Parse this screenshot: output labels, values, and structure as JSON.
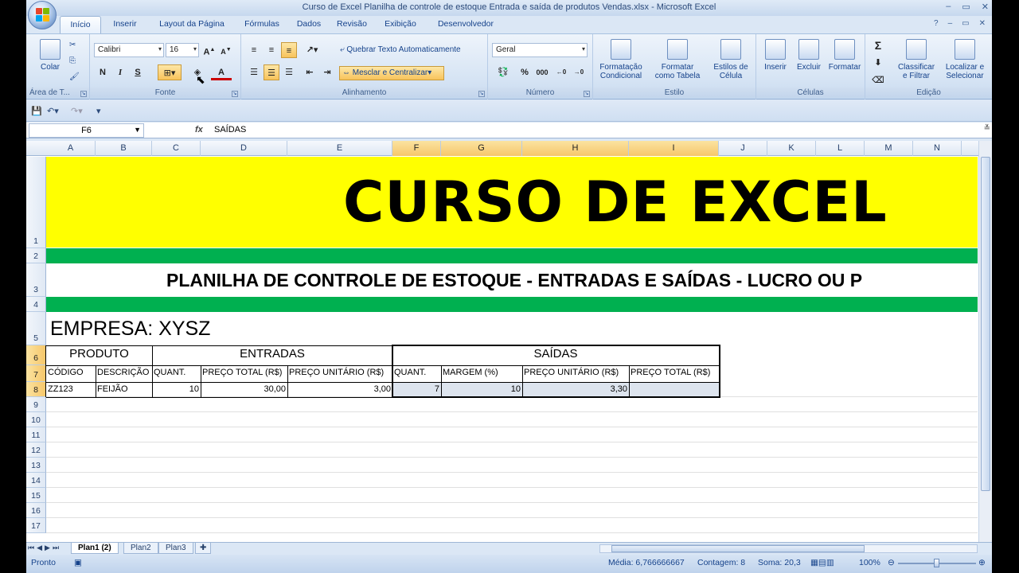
{
  "window": {
    "title": "Curso de Excel Planilha de controle de estoque Entrada e saída de produtos Vendas.xlsx - Microsoft Excel",
    "controls": [
      "–",
      "▭",
      "✕"
    ]
  },
  "tabs": [
    "Início",
    "Inserir",
    "Layout da Página",
    "Fórmulas",
    "Dados",
    "Revisão",
    "Exibição",
    "Desenvolvedor"
  ],
  "ribbon": {
    "clipboard": {
      "paste": "Colar",
      "label": "Área de T..."
    },
    "font": {
      "name": "Calibri",
      "size": "16",
      "bold": "N",
      "italic": "I",
      "underline": "S",
      "label": "Fonte"
    },
    "alignment": {
      "wrap": "Quebrar Texto Automaticamente",
      "merge": "Mesclar e Centralizar",
      "label": "Alinhamento"
    },
    "number": {
      "format": "Geral",
      "percent": "%",
      "thousands": "000",
      "label": "Número"
    },
    "style": {
      "cond": "Formatação\nCondicional",
      "cond1": "Formatação",
      "cond2": "Condicional",
      "table1": "Formatar",
      "table2": "como Tabela",
      "cell1": "Estilos de",
      "cell2": "Célula",
      "label": "Estilo"
    },
    "cells": {
      "insert": "Inserir",
      "delete": "Excluir",
      "format": "Formatar",
      "label": "Células"
    },
    "editing": {
      "sum": "Σ",
      "sort1": "Classificar",
      "sort2": "e Filtrar",
      "find1": "Localizar e",
      "find2": "Selecionar",
      "label": "Edição"
    }
  },
  "formula_bar": {
    "name_box": "F6",
    "fx": "fx",
    "content": "SAÍDAS"
  },
  "columns": [
    "A",
    "B",
    "C",
    "D",
    "E",
    "F",
    "G",
    "H",
    "I",
    "J",
    "K",
    "L",
    "M",
    "N"
  ],
  "rows": [
    "1",
    "2",
    "3",
    "4",
    "5",
    "6",
    "7",
    "8",
    "9",
    "10",
    "11",
    "12",
    "13",
    "14",
    "15",
    "16",
    "17"
  ],
  "sheet": {
    "title": "CURSO DE EXCEL",
    "subtitle": "PLANILHA DE CONTROLE DE ESTOQUE - ENTRADAS E SAÍDAS - LUCRO OU P",
    "company": "EMPRESA: XYSZ",
    "groups": {
      "produto": "PRODUTO",
      "entradas": "ENTRADAS",
      "saidas": "SAÍDAS"
    },
    "headers": [
      "CÓDIGO",
      "DESCRIÇÃO",
      "QUANT.",
      "PREÇO TOTAL (R$)",
      "PREÇO UNITÁRIO (R$)",
      "QUANT.",
      "MARGEM (%)",
      "PREÇO UNITÁRIO (R$)",
      "PREÇO TOTAL (R$)"
    ],
    "row8": [
      "ZZ123",
      "FEIJÃO",
      "10",
      "30,00",
      "3,00",
      "7",
      "10",
      "3,30",
      ""
    ]
  },
  "sheet_tabs": [
    "Plan1 (2)",
    "Plan2",
    "Plan3"
  ],
  "status": {
    "ready": "Pronto",
    "media": "Média: 6,766666667",
    "contagem": "Contagem: 8",
    "soma": "Soma: 20,3",
    "zoom": "100%"
  },
  "colors": {
    "title_band": "#ffff00",
    "green_band": "#00b050",
    "selection": "#f6c76b"
  }
}
